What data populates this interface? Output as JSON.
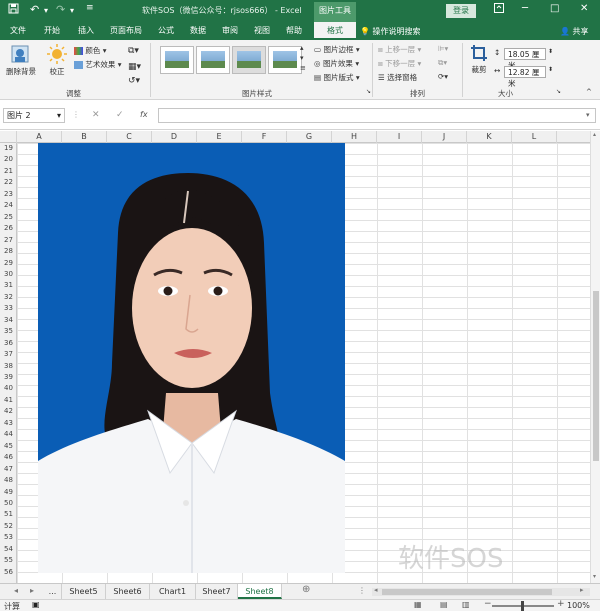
{
  "titlebar": {
    "save_icon": "save-icon",
    "title": "软件SOS（微信公众号：rjsos666） -  Excel",
    "context_tools": "图片工具",
    "login": "登录",
    "restore_icon": "ribbon-display-icon",
    "minimize": "─",
    "maximize": "□",
    "close": "✕"
  },
  "tabs": {
    "file": "文件",
    "home": "开始",
    "insert": "插入",
    "page_layout": "页面布局",
    "formulas": "公式",
    "data": "数据",
    "review": "审阅",
    "view": "视图",
    "help": "帮助",
    "format": "格式",
    "tell_me": "操作说明搜索",
    "share": "共享"
  },
  "ribbon": {
    "adjust": {
      "remove_bg": "删除背景",
      "corrections": "校正",
      "color": "颜色",
      "artistic": "艺术效果",
      "label": "调整"
    },
    "styles": {
      "border": "图片边框",
      "effects": "图片效果",
      "layout": "图片版式",
      "label": "图片样式"
    },
    "arrange": {
      "bring_forward": "上移一层",
      "send_backward": "下移一层",
      "selection_pane": "选择窗格",
      "label": "排列"
    },
    "size": {
      "crop": "裁剪",
      "height": "18.05 厘米",
      "width": "12.82 厘米",
      "label": "大小"
    }
  },
  "formula_bar": {
    "name_box": "图片 2",
    "cancel": "✕",
    "enter": "✓",
    "fx": "fx",
    "formula": ""
  },
  "columns": [
    "A",
    "B",
    "C",
    "D",
    "E",
    "F",
    "G",
    "H",
    "I",
    "J",
    "K",
    "L"
  ],
  "rows": [
    "19",
    "20",
    "21",
    "22",
    "23",
    "24",
    "25",
    "26",
    "27",
    "28",
    "29",
    "30",
    "31",
    "32",
    "33",
    "34",
    "35",
    "36",
    "37",
    "38",
    "39",
    "40",
    "41",
    "42",
    "43",
    "44",
    "45",
    "46",
    "47",
    "48",
    "49",
    "50",
    "51",
    "52",
    "53",
    "54",
    "55",
    "56"
  ],
  "sheets": [
    "...",
    "Sheet5",
    "Sheet6",
    "Chart1",
    "Sheet7",
    "Sheet8"
  ],
  "active_sheet": "Sheet8",
  "watermark": "软件SOS",
  "status": {
    "mode": "计算",
    "zoom": "100%"
  }
}
